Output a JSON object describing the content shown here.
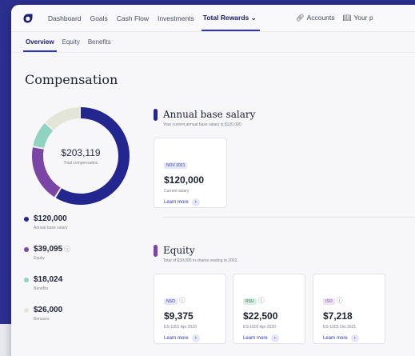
{
  "nav": {
    "items": [
      "Dashboard",
      "Goals",
      "Cash Flow",
      "Investments"
    ],
    "active": "Total Rewards",
    "right": [
      "Accounts",
      "Your p"
    ]
  },
  "subtabs": [
    "Overview",
    "Equity",
    "Benefits"
  ],
  "title": "Compensation",
  "donut": {
    "total": "$203,119",
    "label": "Total compensation",
    "segments": [
      {
        "name": "Annual base salary",
        "value": 120000,
        "color": "#23268f"
      },
      {
        "name": "Equity",
        "value": 39095,
        "color": "#7b45a6"
      },
      {
        "name": "Benefits",
        "value": 18024,
        "color": "#8fd3c0"
      },
      {
        "name": "Bonuses",
        "value": 26000,
        "color": "#e3e5d9"
      }
    ]
  },
  "legend": [
    {
      "value": "$120,000",
      "label": "Annual base salary",
      "color": "#23268f",
      "info": false
    },
    {
      "value": "$39,095",
      "label": "Equity",
      "color": "#7b45a6",
      "info": true
    },
    {
      "value": "$18,024",
      "label": "Benefits",
      "color": "#8fd3c0",
      "info": false
    },
    {
      "value": "$26,000",
      "label": "Bonuses",
      "color": "#e3e5d9",
      "info": false
    }
  ],
  "salary": {
    "title": "Annual base salary",
    "subtitle": "Your current annual base salary is $120,000.",
    "tile": {
      "tag": "NOV 2021",
      "value": "$120,000",
      "sub": "Current salary",
      "link": "Learn more"
    }
  },
  "equity": {
    "title": "Equity",
    "subtitle": "Total of $39,095 in shares vesting in 2022.",
    "tiles": [
      {
        "tag": "NSO",
        "value": "$9,375",
        "sub": "ES-1001 Apr 2018",
        "link": "Learn more",
        "tag_bg": "#e4e6f6",
        "tag_fg": "#3a3f9e"
      },
      {
        "tag": "RSU",
        "value": "$22,500",
        "sub": "ES-1002 Apr 2020",
        "link": "Learn more",
        "tag_bg": "#d8f0e3",
        "tag_fg": "#2b7a55"
      },
      {
        "tag": "ISO",
        "value": "$7,218",
        "sub": "ES-1003 Oct 2021",
        "link": "Learn more",
        "tag_bg": "#efe2f5",
        "tag_fg": "#7b45a6"
      }
    ]
  }
}
